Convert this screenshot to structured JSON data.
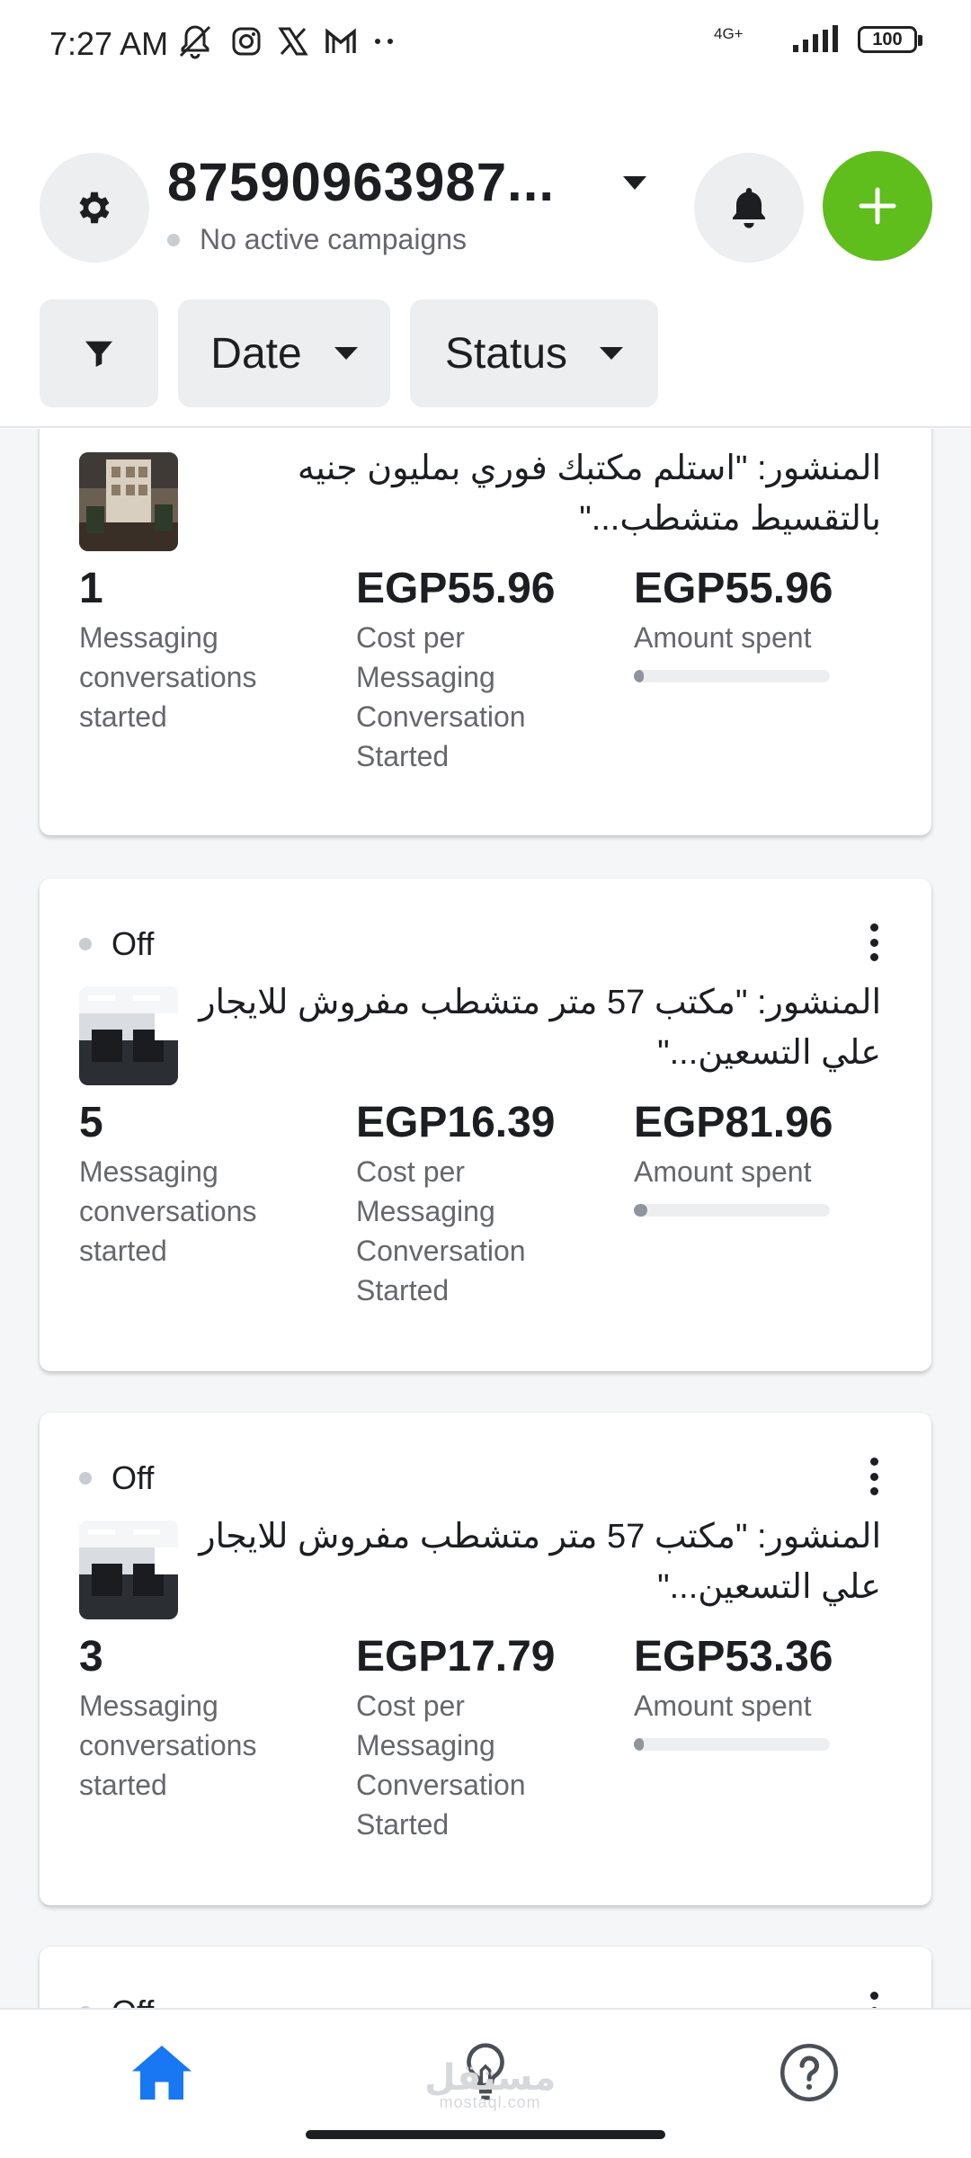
{
  "status_bar": {
    "time": "7:27 AM",
    "network": "4G+",
    "battery": "100",
    "icons": [
      "mute-icon",
      "instagram-icon",
      "x-icon",
      "gmail-icon",
      "more-dots-icon",
      "signal-icon",
      "battery-icon"
    ]
  },
  "header": {
    "account_id": "87590963987...",
    "campaign_status": "No active campaigns",
    "filters": {
      "date_label": "Date",
      "status_label": "Status"
    },
    "colors": {
      "add_button": "#5fbd1c",
      "chip_bg": "#edeef0"
    }
  },
  "cards": [
    {
      "status": "",
      "post_title": "المنشور: \"استلم مكتبك فوري بمليون جنيه بالتقسيط متشطب...\"",
      "metrics": [
        {
          "value": "1",
          "label": "Messaging conversations started"
        },
        {
          "value": "EGP55.96",
          "label": "Cost per Messaging Conversation Started"
        },
        {
          "value": "EGP55.96",
          "label": "Amount spent"
        }
      ],
      "spend_progress": 0.05
    },
    {
      "status": "Off",
      "post_title": "المنشور: \"مكتب 57 متر متشطب مفروش للايجار علي التسعين...\"",
      "metrics": [
        {
          "value": "5",
          "label": "Messaging conversations started"
        },
        {
          "value": "EGP16.39",
          "label": "Cost per Messaging Conversation Started"
        },
        {
          "value": "EGP81.96",
          "label": "Amount spent"
        }
      ],
      "spend_progress": 0.07
    },
    {
      "status": "Off",
      "post_title": "المنشور: \"مكتب 57 متر متشطب مفروش للايجار علي التسعين...\"",
      "metrics": [
        {
          "value": "3",
          "label": "Messaging conversations started"
        },
        {
          "value": "EGP17.79",
          "label": "Cost per Messaging Conversation Started"
        },
        {
          "value": "EGP53.36",
          "label": "Amount spent"
        }
      ],
      "spend_progress": 0.05
    },
    {
      "status": "Off"
    }
  ],
  "bottom_nav": {
    "items": [
      "home-icon",
      "lightbulb-icon",
      "help-icon"
    ],
    "active_color": "#1877f2"
  },
  "watermark": {
    "line1": "مستقل",
    "line2": "mostaql.com"
  }
}
